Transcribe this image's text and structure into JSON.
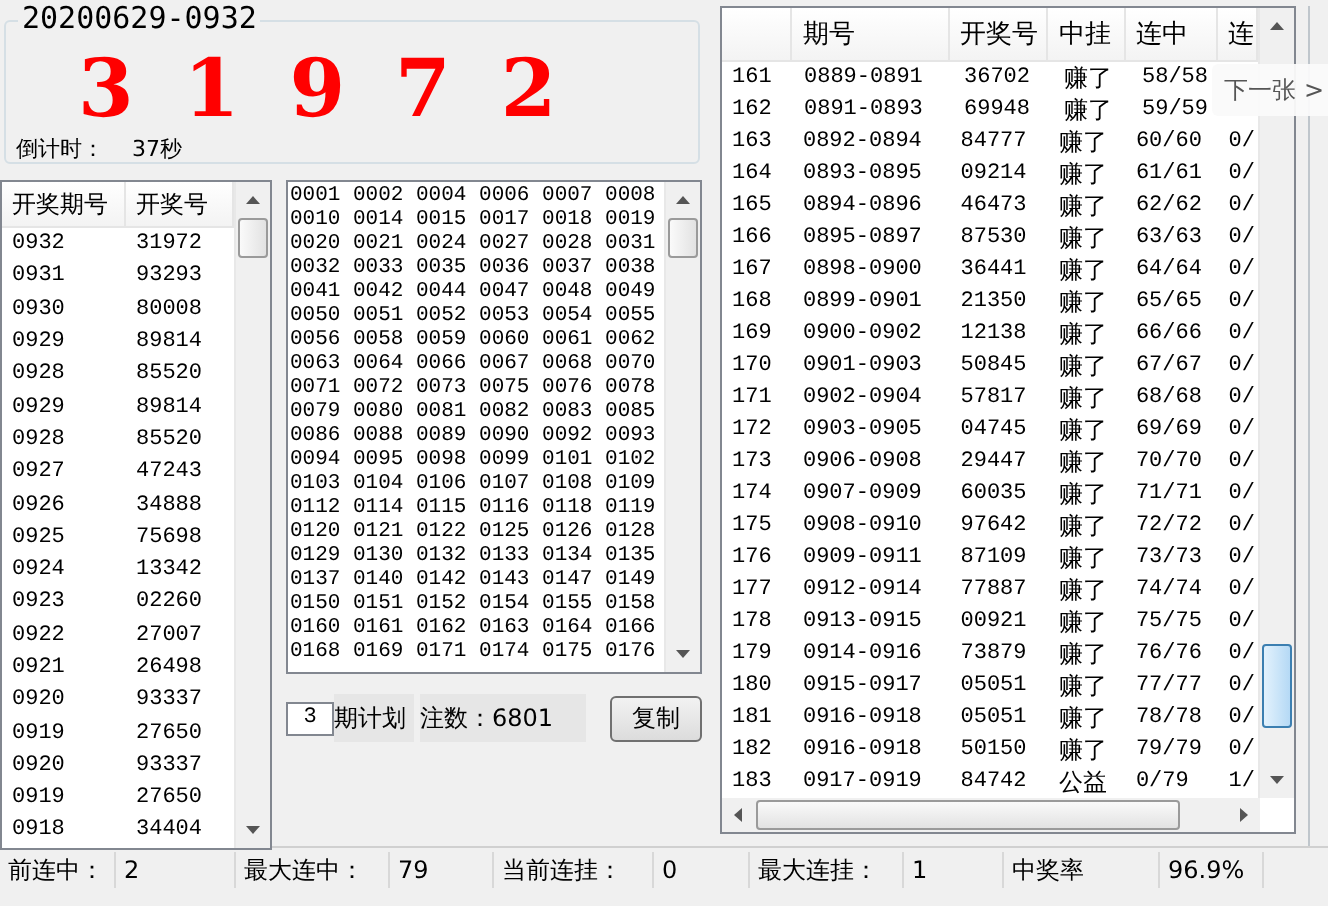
{
  "draw": {
    "issue": "20200629-0932",
    "digits": [
      "3",
      "1",
      "9",
      "7",
      "2"
    ],
    "countdown_label": "倒计时：",
    "countdown_value": "37秒"
  },
  "history": {
    "columns": [
      "开奖期号",
      "开奖号"
    ],
    "rows": [
      [
        "0932",
        "31972"
      ],
      [
        "0931",
        "93293"
      ],
      [
        "0930",
        "80008"
      ],
      [
        "0929",
        "89814"
      ],
      [
        "0928",
        "85520"
      ],
      [
        "0929",
        "89814"
      ],
      [
        "0928",
        "85520"
      ],
      [
        "0927",
        "47243"
      ],
      [
        "0926",
        "34888"
      ],
      [
        "0925",
        "75698"
      ],
      [
        "0924",
        "13342"
      ],
      [
        "0923",
        "02260"
      ],
      [
        "0922",
        "27007"
      ],
      [
        "0921",
        "26498"
      ],
      [
        "0920",
        "93337"
      ],
      [
        "0919",
        "27650"
      ],
      [
        "0920",
        "93337"
      ],
      [
        "0919",
        "27650"
      ],
      [
        "0918",
        "34404"
      ]
    ]
  },
  "plan": {
    "numbers": [
      "0001 0002 0004 0006 0007 0008",
      "0010 0014 0015 0017 0018 0019",
      "0020 0021 0024 0027 0028 0031",
      "0032 0033 0035 0036 0037 0038",
      "0041 0042 0044 0047 0048 0049",
      "0050 0051 0052 0053 0054 0055",
      "0056 0058 0059 0060 0061 0062",
      "0063 0064 0066 0067 0068 0070",
      "0071 0072 0073 0075 0076 0078",
      "0079 0080 0081 0082 0083 0085",
      "0086 0088 0089 0090 0092 0093",
      "0094 0095 0098 0099 0101 0102",
      "0103 0104 0106 0107 0108 0109",
      "0112 0114 0115 0116 0118 0119",
      "0120 0121 0122 0125 0126 0128",
      "0129 0130 0132 0133 0134 0135",
      "0137 0140 0142 0143 0147 0149",
      "0150 0151 0152 0154 0155 0158",
      "0160 0161 0162 0163 0164 0166",
      "0168 0169 0171 0174 0175 0176"
    ],
    "periods": "3",
    "periods_label": "期计划",
    "count": "注数：6801",
    "copy_button": "复制"
  },
  "results": {
    "columns": [
      "",
      "期号",
      "开奖号",
      "中挂",
      "连中",
      "连"
    ],
    "rows": [
      [
        "161",
        "0889-0891",
        "36702",
        "赚了",
        "58/58"
      ],
      [
        "162",
        "0891-0893",
        "69948",
        "赚了",
        "59/59"
      ],
      [
        "163",
        "0892-0894",
        "84777",
        "赚了",
        "60/60",
        "0/"
      ],
      [
        "164",
        "0893-0895",
        "09214",
        "赚了",
        "61/61",
        "0/"
      ],
      [
        "165",
        "0894-0896",
        "46473",
        "赚了",
        "62/62",
        "0/"
      ],
      [
        "166",
        "0895-0897",
        "87530",
        "赚了",
        "63/63",
        "0/"
      ],
      [
        "167",
        "0898-0900",
        "36441",
        "赚了",
        "64/64",
        "0/"
      ],
      [
        "168",
        "0899-0901",
        "21350",
        "赚了",
        "65/65",
        "0/"
      ],
      [
        "169",
        "0900-0902",
        "12138",
        "赚了",
        "66/66",
        "0/"
      ],
      [
        "170",
        "0901-0903",
        "50845",
        "赚了",
        "67/67",
        "0/"
      ],
      [
        "171",
        "0902-0904",
        "57817",
        "赚了",
        "68/68",
        "0/"
      ],
      [
        "172",
        "0903-0905",
        "04745",
        "赚了",
        "69/69",
        "0/"
      ],
      [
        "173",
        "0906-0908",
        "29447",
        "赚了",
        "70/70",
        "0/"
      ],
      [
        "174",
        "0907-0909",
        "60035",
        "赚了",
        "71/71",
        "0/"
      ],
      [
        "175",
        "0908-0910",
        "97642",
        "赚了",
        "72/72",
        "0/"
      ],
      [
        "176",
        "0909-0911",
        "87109",
        "赚了",
        "73/73",
        "0/"
      ],
      [
        "177",
        "0912-0914",
        "77887",
        "赚了",
        "74/74",
        "0/"
      ],
      [
        "178",
        "0913-0915",
        "00921",
        "赚了",
        "75/75",
        "0/"
      ],
      [
        "179",
        "0914-0916",
        "73879",
        "赚了",
        "76/76",
        "0/"
      ],
      [
        "180",
        "0915-0917",
        "05051",
        "赚了",
        "77/77",
        "0/"
      ],
      [
        "181",
        "0916-0918",
        "05051",
        "赚了",
        "78/78",
        "0/"
      ],
      [
        "182",
        "0916-0918",
        "50150",
        "赚了",
        "79/79",
        "0/"
      ],
      [
        "183",
        "0917-0919",
        "84742",
        "公益",
        "0/79",
        "1/"
      ]
    ]
  },
  "status": [
    {
      "label": "前连中：",
      "value": "2"
    },
    {
      "label": "最大连中：",
      "value": "79"
    },
    {
      "label": "当前连挂：",
      "value": "0"
    },
    {
      "label": "最大连挂：",
      "value": "1"
    },
    {
      "label": "中奖率",
      "value": "96.9%"
    }
  ],
  "overlay": {
    "label": "下一张",
    "arrow": ">"
  }
}
